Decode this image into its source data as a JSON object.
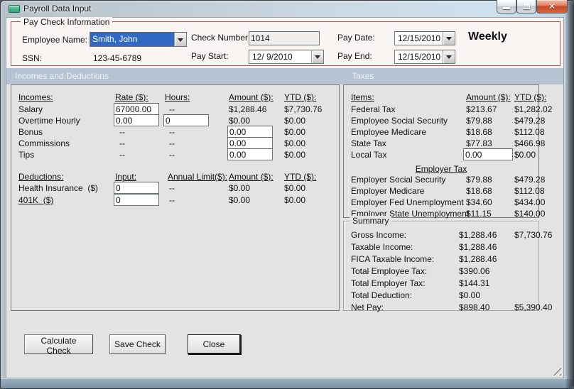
{
  "window": {
    "title": "Payroll Data Input"
  },
  "paycheck_info": {
    "group_label": "Pay Check Information",
    "employee_name_label": "Employee Name:",
    "employee_name_value": "Smith, John",
    "ssn_label": "SSN:",
    "ssn_value": "123-45-6789",
    "check_number_label": "Check Number:",
    "check_number_value": "1014",
    "pay_start_label": "Pay Start:",
    "pay_start_value": "12/ 9/2010",
    "pay_date_label": "Pay Date:",
    "pay_date_value": "12/15/2010",
    "pay_end_label": "Pay End:",
    "pay_end_value": "12/15/2010",
    "frequency": "Weekly"
  },
  "sections": {
    "incomes_deductions_label": "Incomes and Deductions",
    "taxes_label": "Taxes"
  },
  "incomes": {
    "headers": [
      "Incomes:",
      "Rate ($):",
      "Hours:",
      "Amount ($):",
      "YTD ($):"
    ],
    "rows": [
      {
        "label": "Salary",
        "rate": "67000.00",
        "hours": "--",
        "amount": "$1,288.46",
        "ytd": "$7,730.76"
      },
      {
        "label": "Overtime Hourly",
        "rate": "0.00",
        "hours": "0",
        "amount": "$0.00",
        "ytd": "$0.00"
      },
      {
        "label": "Bonus",
        "rate": "--",
        "hours": "--",
        "amount": "0.00",
        "ytd": "$0.00"
      },
      {
        "label": "Commissions",
        "rate": "--",
        "hours": "--",
        "amount": "0.00",
        "ytd": "$0.00"
      },
      {
        "label": "Tips",
        "rate": "--",
        "hours": "--",
        "amount": "0.00",
        "ytd": "$0.00"
      }
    ]
  },
  "deductions": {
    "headers": [
      "Deductions:",
      "Input:",
      "Annual Limit($):",
      "Amount ($):",
      "YTD ($):"
    ],
    "rows": [
      {
        "label": "Health Insurance  ($)",
        "input": "0",
        "limit": "--",
        "amount": "$0.00",
        "ytd": "$0.00"
      },
      {
        "label": "401K  ($)",
        "input": "0",
        "limit": "--",
        "amount": "$0.00",
        "ytd": "$0.00"
      }
    ]
  },
  "taxes": {
    "headers": [
      "Items:",
      "Amount ($):",
      "YTD ($):"
    ],
    "employee_rows": [
      {
        "label": "Federal Tax",
        "amount": "$213.67",
        "ytd": "$1,282.02"
      },
      {
        "label": "Employee Social Security",
        "amount": "$79.88",
        "ytd": "$479.28"
      },
      {
        "label": "Employee Medicare",
        "amount": "$18.68",
        "ytd": "$112.08"
      },
      {
        "label": "State Tax",
        "amount": "$77.83",
        "ytd": "$466.98"
      },
      {
        "label": "Local Tax",
        "amount": "0.00",
        "ytd": "$0.00"
      }
    ],
    "employer_header": "Employer Tax",
    "employer_rows": [
      {
        "label": "Employer Social Security",
        "amount": "$79.88",
        "ytd": "$479.28"
      },
      {
        "label": "Employer Medicare",
        "amount": "$18.68",
        "ytd": "$112.08"
      },
      {
        "label": "Employer Fed Unemployment",
        "amount": "$34.60",
        "ytd": "$434.00"
      },
      {
        "label": "Employer State Unemployment",
        "amount": "$11.15",
        "ytd": "$140.00"
      }
    ]
  },
  "summary": {
    "group_label": "Summary",
    "rows": [
      {
        "label": "Gross Income:",
        "amount": "$1,288.46",
        "ytd": "$7,730.76"
      },
      {
        "label": "Taxable Income:",
        "amount": "$1,288.46",
        "ytd": ""
      },
      {
        "label": "FICA Taxable Income:",
        "amount": "$1,288.46",
        "ytd": ""
      },
      {
        "label": "Total Employee Tax:",
        "amount": "$390.06",
        "ytd": ""
      },
      {
        "label": "Total Employer Tax:",
        "amount": "$144.31",
        "ytd": ""
      },
      {
        "label": "Total Deduction:",
        "amount": "$0.00",
        "ytd": ""
      },
      {
        "label": "Net Pay:",
        "amount": "$898.40",
        "ytd": "$5,390.40"
      }
    ]
  },
  "buttons": {
    "calculate": "Calculate Check",
    "save": "Save Check",
    "close": "Close"
  },
  "colors": {
    "group_border": "#b0574f",
    "section_band": "#b6c3d2",
    "selection_blue": "#316ac5",
    "close_button_red": "#c54a2c"
  }
}
